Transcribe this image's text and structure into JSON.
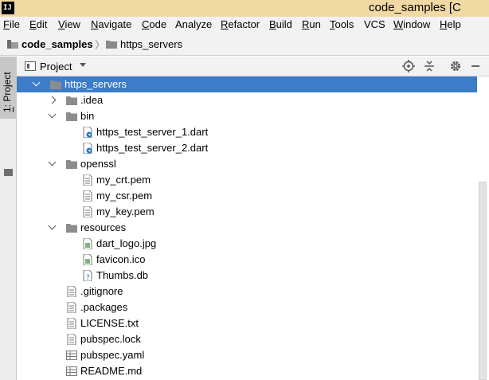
{
  "window": {
    "logo": "IJ",
    "title": "code_samples [C"
  },
  "menu": [
    {
      "label": "File",
      "mn": "F",
      "rest": "ile"
    },
    {
      "label": "Edit",
      "mn": "E",
      "rest": "dit"
    },
    {
      "label": "View",
      "mn": "V",
      "rest": "iew"
    },
    {
      "label": "Navigate",
      "mn": "N",
      "rest": "avigate"
    },
    {
      "label": "Code",
      "mn": "C",
      "rest": "ode"
    },
    {
      "label": "Analyze",
      "mn": "",
      "rest": "Analyze"
    },
    {
      "label": "Refactor",
      "mn": "R",
      "rest": "efactor"
    },
    {
      "label": "Build",
      "mn": "B",
      "rest": "uild"
    },
    {
      "label": "Run",
      "mn": "R",
      "rest": "un"
    },
    {
      "label": "Tools",
      "mn": "T",
      "rest": "ools"
    },
    {
      "label": "VCS",
      "mn": "",
      "rest": "VCS"
    },
    {
      "label": "Window",
      "mn": "W",
      "rest": "indow"
    },
    {
      "label": "Help",
      "mn": "H",
      "rest": "elp"
    }
  ],
  "breadcrumb": {
    "project": "code_samples",
    "folder": "https_servers"
  },
  "sidebar": {
    "tool_number": "1",
    "tool_label": ": Project"
  },
  "panel": {
    "title": "Project"
  },
  "tree": [
    {
      "label": "https_servers",
      "icon": "folder-icon",
      "depth": 0,
      "arrow": "down",
      "selected": true
    },
    {
      "label": ".idea",
      "icon": "folder-icon",
      "depth": 1,
      "arrow": "right"
    },
    {
      "label": "bin",
      "icon": "folder-icon",
      "depth": 1,
      "arrow": "down"
    },
    {
      "label": "https_test_server_1.dart",
      "icon": "dart-file-icon",
      "depth": 2
    },
    {
      "label": "https_test_server_2.dart",
      "icon": "dart-file-icon",
      "depth": 2
    },
    {
      "label": "openssl",
      "icon": "folder-icon",
      "depth": 1,
      "arrow": "down"
    },
    {
      "label": "my_crt.pem",
      "icon": "text-file-icon",
      "depth": 2
    },
    {
      "label": "my_csr.pem",
      "icon": "text-file-icon",
      "depth": 2
    },
    {
      "label": "my_key.pem",
      "icon": "text-file-icon",
      "depth": 2
    },
    {
      "label": "resources",
      "icon": "folder-icon",
      "depth": 1,
      "arrow": "down"
    },
    {
      "label": "dart_logo.jpg",
      "icon": "image-file-icon",
      "depth": 2
    },
    {
      "label": "favicon.ico",
      "icon": "image-file-icon",
      "depth": 2
    },
    {
      "label": "Thumbs.db",
      "icon": "unknown-file-icon",
      "depth": 2
    },
    {
      "label": ".gitignore",
      "icon": "text-file-icon",
      "depth": 1
    },
    {
      "label": ".packages",
      "icon": "text-file-icon",
      "depth": 1
    },
    {
      "label": "LICENSE.txt",
      "icon": "text-file-icon",
      "depth": 1
    },
    {
      "label": "pubspec.lock",
      "icon": "text-file-icon",
      "depth": 1
    },
    {
      "label": "pubspec.yaml",
      "icon": "table-file-icon",
      "depth": 1
    },
    {
      "label": "README.md",
      "icon": "table-file-icon",
      "depth": 1
    }
  ],
  "colors": {
    "selection": "#3d7cc9",
    "titlebar": "#f1d9a4",
    "chrome": "#f2f2f2"
  }
}
